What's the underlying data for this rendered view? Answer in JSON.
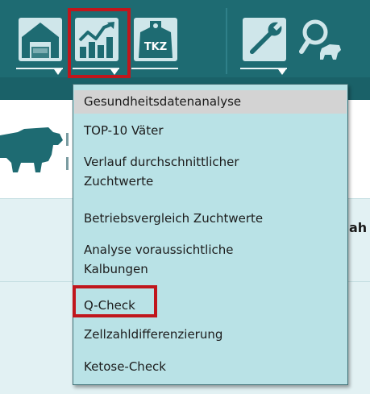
{
  "toolbar": {
    "buttons": [
      {
        "name": "barn-icon",
        "highlighted": false
      },
      {
        "name": "chart-icon",
        "highlighted": true
      },
      {
        "name": "ear-tag-icon",
        "label": "TKZ",
        "highlighted": false
      },
      {
        "name": "wrench-icon",
        "highlighted": false
      },
      {
        "name": "search-cow-icon",
        "highlighted": false
      }
    ],
    "colors": {
      "bar": "#1e6b72",
      "tile": "#cfe6ea",
      "highlight": "#c0161c"
    }
  },
  "menu": {
    "items": [
      {
        "label": "Gesundheitsdatenanalyse",
        "active": true
      },
      {
        "label": "TOP-10 Väter"
      },
      {
        "label": "Verlauf durchschnittlicher Zuchtwerte"
      },
      {
        "label": "Betriebsvergleich Zuchtwerte"
      },
      {
        "label": "Analyse voraussichtliche Kalbungen"
      },
      {
        "label": "Q-Check",
        "highlighted": true
      },
      {
        "label": "Zellzahldifferenzierung"
      },
      {
        "label": "Ketose-Check"
      }
    ]
  },
  "background": {
    "peek_text": "ah"
  }
}
